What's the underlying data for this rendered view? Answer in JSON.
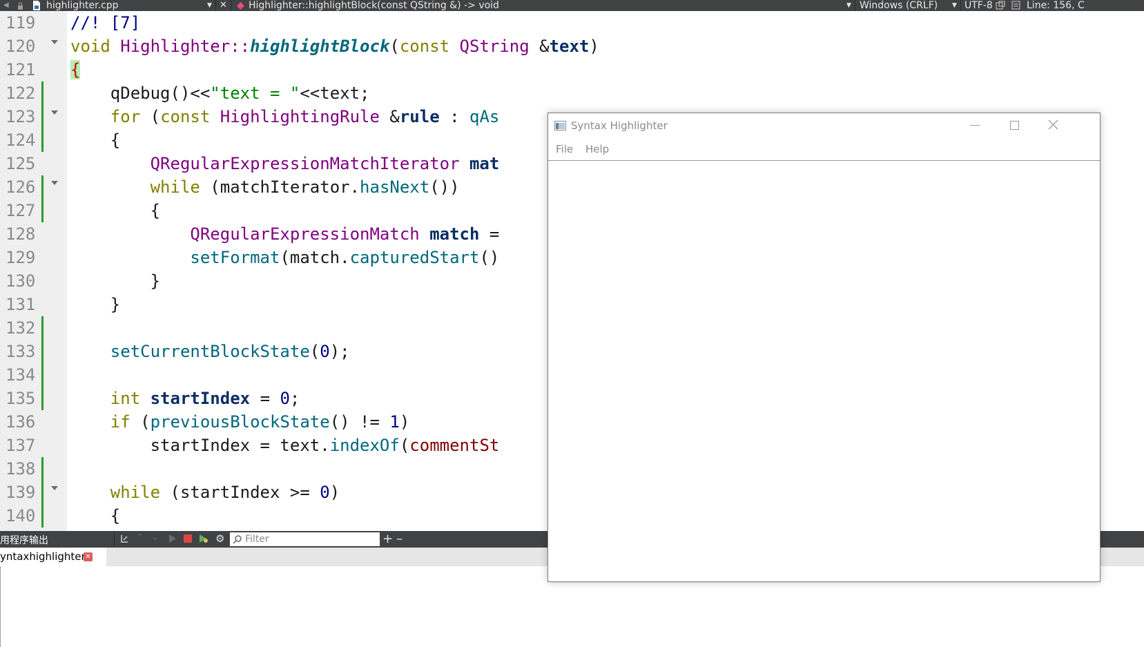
{
  "topbar": {
    "file_name": "highlighter.cpp",
    "symbol": "Highlighter::highlightBlock(const QString &) -> void",
    "line_ending": "Windows (CRLF)",
    "encoding": "UTF-8",
    "cursor": "Line: 156, C"
  },
  "editor": {
    "line_numbers": [
      "119",
      "120",
      "121",
      "122",
      "123",
      "124",
      "125",
      "126",
      "127",
      "128",
      "129",
      "130",
      "131",
      "132",
      "133",
      "134",
      "135",
      "136",
      "137",
      "138",
      "139",
      "140"
    ],
    "code": {
      "l119": "//! [7]",
      "l120_kw": "void",
      "l120_cls": "Highlighter::",
      "l120_fn": "highlightBlock",
      "l120_p1": "(",
      "l120_const": "const",
      "l120_ty": "QString",
      "l120_amp": "&",
      "l120_param": "text",
      "l120_p2": ")",
      "l121": "{",
      "l122_a": "qDebug()<<",
      "l122_str": "\"text = \"",
      "l122_b": "<<text;",
      "l123_kw": "for",
      "l123_a": "(",
      "l123_const": "const",
      "l123_ty": "HighlightingRule",
      "l123_amp": "&",
      "l123_var": "rule",
      "l123_b": ":",
      "l123_fn": "qAs",
      "l124": "{",
      "l125_ty": "QRegularExpressionMatchIterator",
      "l125_var": "mat",
      "l126_kw": "while",
      "l126_a": "(matchIterator.",
      "l126_fn": "hasNext",
      "l126_b": "())",
      "l127": "{",
      "l128_ty": "QRegularExpressionMatch",
      "l128_var": "match",
      "l128_a": "=",
      "l129_fn": "setFormat",
      "l129_a": "(match.",
      "l129_fn2": "capturedStart",
      "l129_b": "()",
      "l130": "}",
      "l131": "}",
      "l133_fn": "setCurrentBlockState",
      "l133_a": "(",
      "l133_num": "0",
      "l133_b": ");",
      "l135_kw": "int",
      "l135_var": "startIndex",
      "l135_a": "=",
      "l135_num": "0",
      "l135_b": ";",
      "l136_kw": "if",
      "l136_a": "(",
      "l136_fn": "previousBlockState",
      "l136_b": "() != ",
      "l136_num": "1",
      "l136_c": ")",
      "l137_a": "startIndex = text.",
      "l137_fn": "indexOf",
      "l137_b": "(",
      "l137_var": "commentSt",
      "l139_kw": "while",
      "l139_a": "(startIndex >= ",
      "l139_num": "0",
      "l139_b": ")",
      "l140": "{"
    }
  },
  "output": {
    "title": "用程序输出",
    "filter_placeholder": "Filter",
    "tab_label": "yntaxhighlighter"
  },
  "window": {
    "title": "Syntax Highlighter",
    "menu_file": "File",
    "menu_help": "Help"
  },
  "colors": {
    "panel_dark": "#404244",
    "gutter_modified": "#2b9a2b",
    "keyword": "#808000",
    "type": "#800080",
    "function": "#00677c"
  }
}
